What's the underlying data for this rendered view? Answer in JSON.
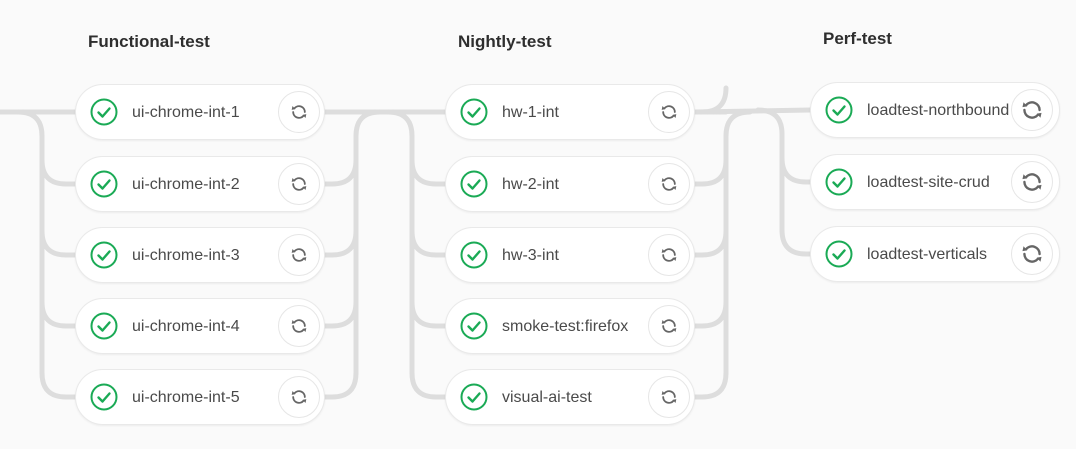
{
  "stages": [
    {
      "title": "Functional-test",
      "jobs": [
        {
          "name": "ui-chrome-int-1",
          "status": "success"
        },
        {
          "name": "ui-chrome-int-2",
          "status": "success"
        },
        {
          "name": "ui-chrome-int-3",
          "status": "success"
        },
        {
          "name": "ui-chrome-int-4",
          "status": "success"
        },
        {
          "name": "ui-chrome-int-5",
          "status": "success"
        }
      ]
    },
    {
      "title": "Nightly-test",
      "jobs": [
        {
          "name": "hw-1-int",
          "status": "success"
        },
        {
          "name": "hw-2-int",
          "status": "success"
        },
        {
          "name": "hw-3-int",
          "status": "success"
        },
        {
          "name": "smoke-test:firefox",
          "status": "success"
        },
        {
          "name": "visual-ai-test",
          "status": "success"
        }
      ]
    },
    {
      "title": "Perf-test",
      "jobs": [
        {
          "name": "loadtest-northbound",
          "status": "success"
        },
        {
          "name": "loadtest-site-crud",
          "status": "success"
        },
        {
          "name": "loadtest-verticals",
          "status": "success"
        }
      ]
    }
  ],
  "icons": {
    "status": "check-circle-icon",
    "retry": "retry-icon"
  },
  "colors": {
    "success": "#1aaa55",
    "connector": "#dddddd",
    "retry_icon": "#666666"
  }
}
